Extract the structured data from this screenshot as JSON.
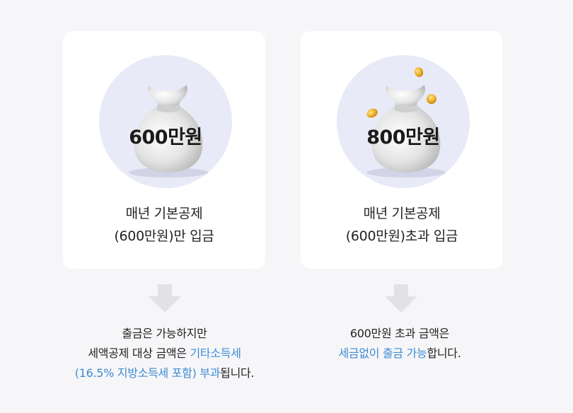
{
  "cards": [
    {
      "amount": "600만원",
      "line1": "매년 기본공제",
      "line2": "(600만원)만 입금",
      "coins": false
    },
    {
      "amount": "800만원",
      "line1": "매년 기본공제",
      "line2": "(600만원)초과 입금",
      "coins": true
    }
  ],
  "notes": {
    "left": {
      "line1": "출금은 가능하지만",
      "line2_plain": "세액공제 대상 금액은 ",
      "line2_hl": "기타소득세",
      "line3_hl": "(16.5% 지방소득세 포함) 부과",
      "line3_plain": "됩니다."
    },
    "right": {
      "line1": "600만원 초과 금액은",
      "line2_hl": "세금없이 출금 가능",
      "line2_plain": "합니다."
    }
  },
  "colors": {
    "background": "#f6f6f8",
    "card": "#ffffff",
    "circle": "#e9eaf8",
    "highlight": "#3d8bd6",
    "arrow": "#e2e2e6",
    "coin": "#e5a41a"
  }
}
